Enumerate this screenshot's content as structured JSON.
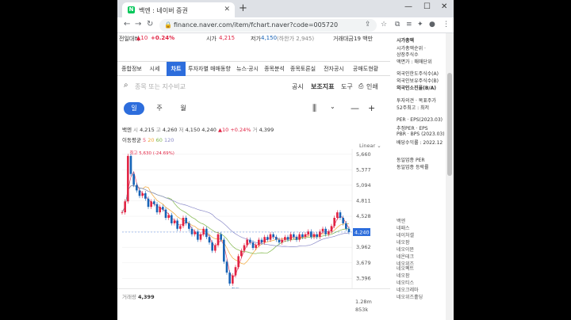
{
  "browser": {
    "tab_title": "백엔 : 네이버 증권",
    "tab_favicon": "N",
    "url": "finance.naver.com/item/fchart.naver?code=005720"
  },
  "quote_band": {
    "prev_label": "전일대비",
    "change": "▲10",
    "change_pct": "+0.24%",
    "high_label": "시가",
    "high": "4,215",
    "low_label": "저가",
    "low": "4,150",
    "lower_limit": "(하한가 2,945)",
    "amount_label": "거래대금",
    "amount": "19 백만"
  },
  "main_tabs": [
    {
      "label": "종합정보"
    },
    {
      "label": "시세"
    },
    {
      "label": "차트",
      "active": true
    },
    {
      "label": "투자자별 매매동향"
    },
    {
      "label": "뉴스·공시"
    },
    {
      "label": "종목분석"
    },
    {
      "label": "종목토론실"
    },
    {
      "label": "전자공시"
    },
    {
      "label": "공매도현황"
    }
  ],
  "toolbar": {
    "search_placeholder": "종목 또는 지수비교",
    "disclosure": "공시",
    "indicator": "보조지표",
    "tool": "도구",
    "print": "인쇄"
  },
  "periods": [
    {
      "label": "일",
      "active": true
    },
    {
      "label": "주"
    },
    {
      "label": "월"
    }
  ],
  "chart_info": {
    "name": "백엔",
    "open_label": "시",
    "open": "4,215",
    "high_label": "고",
    "high": "4,260",
    "low_label": "저",
    "low": "4,150",
    "close": "4,240",
    "change": "▲10",
    "change_pct": "+0.24%",
    "vol_label": "거",
    "vol": "4,399",
    "ma_label": "이동평균",
    "ma5": "5",
    "ma20": "20",
    "ma60": "60",
    "ma120": "120",
    "scale": "Linear",
    "max_note": "최고 5,630 (-24.69%)",
    "min_note": "최저 3,300 (28.48%)",
    "current_tag": "4,240",
    "volume_label": "거래량",
    "volume": "4,399",
    "vol_ticks": [
      "1.28m",
      "853k"
    ]
  },
  "chart_data": {
    "type": "line",
    "title": "",
    "ylim": [
      3300,
      5700
    ],
    "yticks": [
      "5,660",
      "5,377",
      "5,094",
      "4,811",
      "4,528",
      "4,245",
      "3,962",
      "3,679",
      "3,396"
    ],
    "close": [
      4600,
      4800,
      5630,
      5300,
      5100,
      5000,
      4900,
      4950,
      4850,
      4700,
      4800,
      4750,
      4600,
      4700,
      4650,
      4500,
      4550,
      4400,
      4450,
      4300,
      4350,
      4500,
      4400,
      4300,
      4200,
      4250,
      4100,
      4200,
      4300,
      4150,
      4050,
      3900,
      4000,
      4200,
      4100,
      3700,
      3500,
      3300,
      3450,
      3600,
      3800,
      3900,
      4000,
      4100,
      4050,
      3950,
      4000,
      4100,
      4050,
      4150,
      4100,
      4200,
      4150,
      4100,
      4050,
      4100,
      4150,
      4100,
      4200,
      4150,
      4100,
      4200,
      4150,
      4200,
      4250,
      4150,
      4200,
      4150,
      4250,
      4300,
      4200,
      4250,
      4350,
      4500,
      4600,
      4500,
      4400,
      4300,
      4240
    ],
    "ma_colors": [
      "#e84b6a",
      "#f2a83a",
      "#7fb648",
      "#8a8ac8"
    ]
  },
  "sidebar": {
    "items": [
      "시가총액",
      "시가총액순위 ·",
      "상장주식수",
      "액면가 : 매매단위",
      "외국인한도주식수(A)",
      "외국인보유주식수(B)",
      "외국인소진율(B/A)",
      "투자의견 · 목표주가",
      "52주최고 : 최저",
      "PER · EPS(2023.03)",
      "추정PER · EPS",
      "PBR · BPS (2023.03)",
      "배당수익률 : 2022.12",
      "동일업종 PER",
      "동일업종 등락률"
    ],
    "recent_header": "최근조회",
    "recent": [
      "백엔",
      "네패스",
      "네이처셀",
      "네오팜",
      "네오이뮨",
      "네온테크",
      "네오위즈"
    ],
    "more": [
      "네오펙트",
      "네오팜",
      "네오티스",
      "네오크레마",
      "네오위즈홀딩"
    ]
  }
}
